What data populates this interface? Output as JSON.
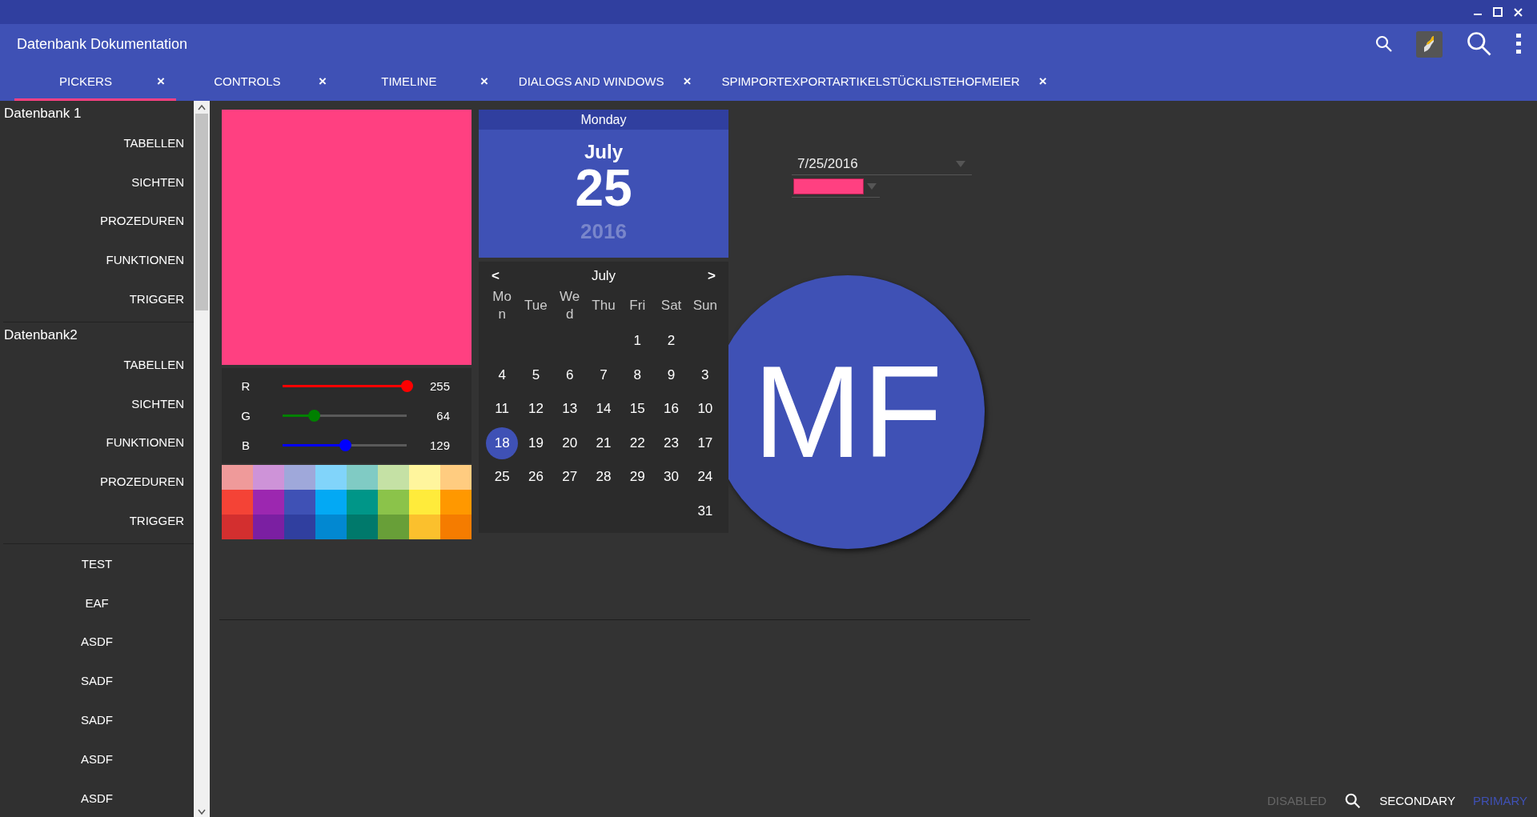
{
  "window": {
    "title": "Datenbank Dokumentation"
  },
  "tabs": [
    {
      "label": "PICKERS",
      "selected": true,
      "close": "×"
    },
    {
      "label": "CONTROLS",
      "selected": false,
      "close": "×"
    },
    {
      "label": "TIMELINE",
      "selected": false,
      "close": "×"
    },
    {
      "label": "DIALOGS AND WINDOWS",
      "selected": false,
      "close": "×"
    },
    {
      "label": "SPIMPORTEXPORTARTIKELSTÜCKLISTEHOFMEIER",
      "selected": false,
      "close": "×"
    }
  ],
  "sidebar": {
    "groups": [
      {
        "title": "Datenbank 1",
        "items": [
          "TABELLEN",
          "SICHTEN",
          "PROZEDUREN",
          "FUNKTIONEN",
          "TRIGGER"
        ]
      },
      {
        "title": "Datenbank2",
        "items": [
          "TABELLEN",
          "SICHTEN",
          "FUNKTIONEN",
          "PROZEDUREN",
          "TRIGGER"
        ]
      },
      {
        "items": [
          "TEST",
          "EAF",
          "ASDF",
          "SADF",
          "SADF",
          "ASDF",
          "ASDF"
        ]
      }
    ]
  },
  "color_picker": {
    "color": "#ff4081",
    "channels": [
      {
        "name": "R",
        "value": "255",
        "level": 1,
        "color": "#ff0000"
      },
      {
        "name": "G",
        "value": "64",
        "level": 0.25,
        "color": "#008000"
      },
      {
        "name": "B",
        "value": "129",
        "level": 0.5,
        "color": "#0000ff"
      }
    ],
    "swatches": [
      [
        {
          "color": "#ef9a9a"
        },
        {
          "color": "#ce93d8"
        },
        {
          "color": "#9fa8da"
        },
        {
          "color": "#81d4fa"
        },
        {
          "color": "#80cbc4"
        },
        {
          "color": "#c5e1a5"
        },
        {
          "color": "#fff59d"
        },
        {
          "color": "#ffcc80"
        }
      ],
      [
        {
          "color": "#f44336"
        },
        {
          "color": "#9c27b0"
        },
        {
          "color": "#3f51b5"
        },
        {
          "color": "#03a9f4"
        },
        {
          "color": "#009688"
        },
        {
          "color": "#8bc34a"
        },
        {
          "color": "#ffeb3b"
        },
        {
          "color": "#ff9800"
        }
      ],
      [
        {
          "color": "#d32f2f"
        },
        {
          "color": "#7b1fa2"
        },
        {
          "color": "#303f9f"
        },
        {
          "color": "#0288d1"
        },
        {
          "color": "#00796b"
        },
        {
          "color": "#689f38"
        },
        {
          "color": "#fbc02d"
        },
        {
          "color": "#f57c00"
        }
      ]
    ]
  },
  "calendar": {
    "weekday": "Monday",
    "month": "July",
    "day": "25",
    "year": "2016",
    "prev": "<",
    "nav_month": "July",
    "next": ">",
    "weekdays": [
      "Mon",
      "Tue",
      "Wed",
      "Thu",
      "Fri",
      "Sat",
      "Sun"
    ],
    "weeks": [
      [
        {
          "kind": "blank"
        },
        {
          "kind": "blank"
        },
        {
          "kind": "blank"
        },
        {
          "kind": "blank"
        },
        {
          "kind": "day",
          "label": "1",
          "selected": false
        },
        {
          "kind": "day",
          "label": "2",
          "selected": false
        },
        {
          "kind": "blank"
        }
      ],
      [
        {
          "kind": "day",
          "label": "4",
          "selected": false
        },
        {
          "kind": "day",
          "label": "5",
          "selected": false
        },
        {
          "kind": "day",
          "label": "6",
          "selected": false
        },
        {
          "kind": "day",
          "label": "7",
          "selected": false
        },
        {
          "kind": "day",
          "label": "8",
          "selected": false
        },
        {
          "kind": "day",
          "label": "9",
          "selected": false
        },
        {
          "kind": "day",
          "label": "3",
          "selected": false
        }
      ],
      [
        {
          "kind": "day",
          "label": "11",
          "selected": false
        },
        {
          "kind": "day",
          "label": "12",
          "selected": false
        },
        {
          "kind": "day",
          "label": "13",
          "selected": false
        },
        {
          "kind": "day",
          "label": "14",
          "selected": false
        },
        {
          "kind": "day",
          "label": "15",
          "selected": false
        },
        {
          "kind": "day",
          "label": "16",
          "selected": false
        },
        {
          "kind": "day",
          "label": "10",
          "selected": false
        }
      ],
      [
        {
          "kind": "day",
          "label": "18",
          "selected": true
        },
        {
          "kind": "day",
          "label": "19",
          "selected": false
        },
        {
          "kind": "day",
          "label": "20",
          "selected": false
        },
        {
          "kind": "day",
          "label": "21",
          "selected": false
        },
        {
          "kind": "day",
          "label": "22",
          "selected": false
        },
        {
          "kind": "day",
          "label": "23",
          "selected": false
        },
        {
          "kind": "day",
          "label": "17",
          "selected": false
        }
      ],
      [
        {
          "kind": "day",
          "label": "25",
          "selected": false
        },
        {
          "kind": "day",
          "label": "26",
          "selected": false
        },
        {
          "kind": "day",
          "label": "27",
          "selected": false
        },
        {
          "kind": "day",
          "label": "28",
          "selected": false
        },
        {
          "kind": "day",
          "label": "29",
          "selected": false
        },
        {
          "kind": "day",
          "label": "30",
          "selected": false
        },
        {
          "kind": "day",
          "label": "24",
          "selected": false
        }
      ],
      [
        {
          "kind": "blank"
        },
        {
          "kind": "blank"
        },
        {
          "kind": "blank"
        },
        {
          "kind": "blank"
        },
        {
          "kind": "blank"
        },
        {
          "kind": "blank"
        },
        {
          "kind": "day",
          "label": "31",
          "selected": false
        }
      ]
    ]
  },
  "date_field": {
    "value": "7/25/2016"
  },
  "color_field": {
    "color": "#ff4081"
  },
  "avatar": {
    "initials": "MF"
  },
  "footer_buttons": [
    {
      "kind": "disabled",
      "label": "DISABLED"
    },
    {
      "kind": "icon"
    },
    {
      "kind": "secondary",
      "label": "SECONDARY"
    },
    {
      "kind": "primary",
      "label": "PRIMARY"
    }
  ]
}
